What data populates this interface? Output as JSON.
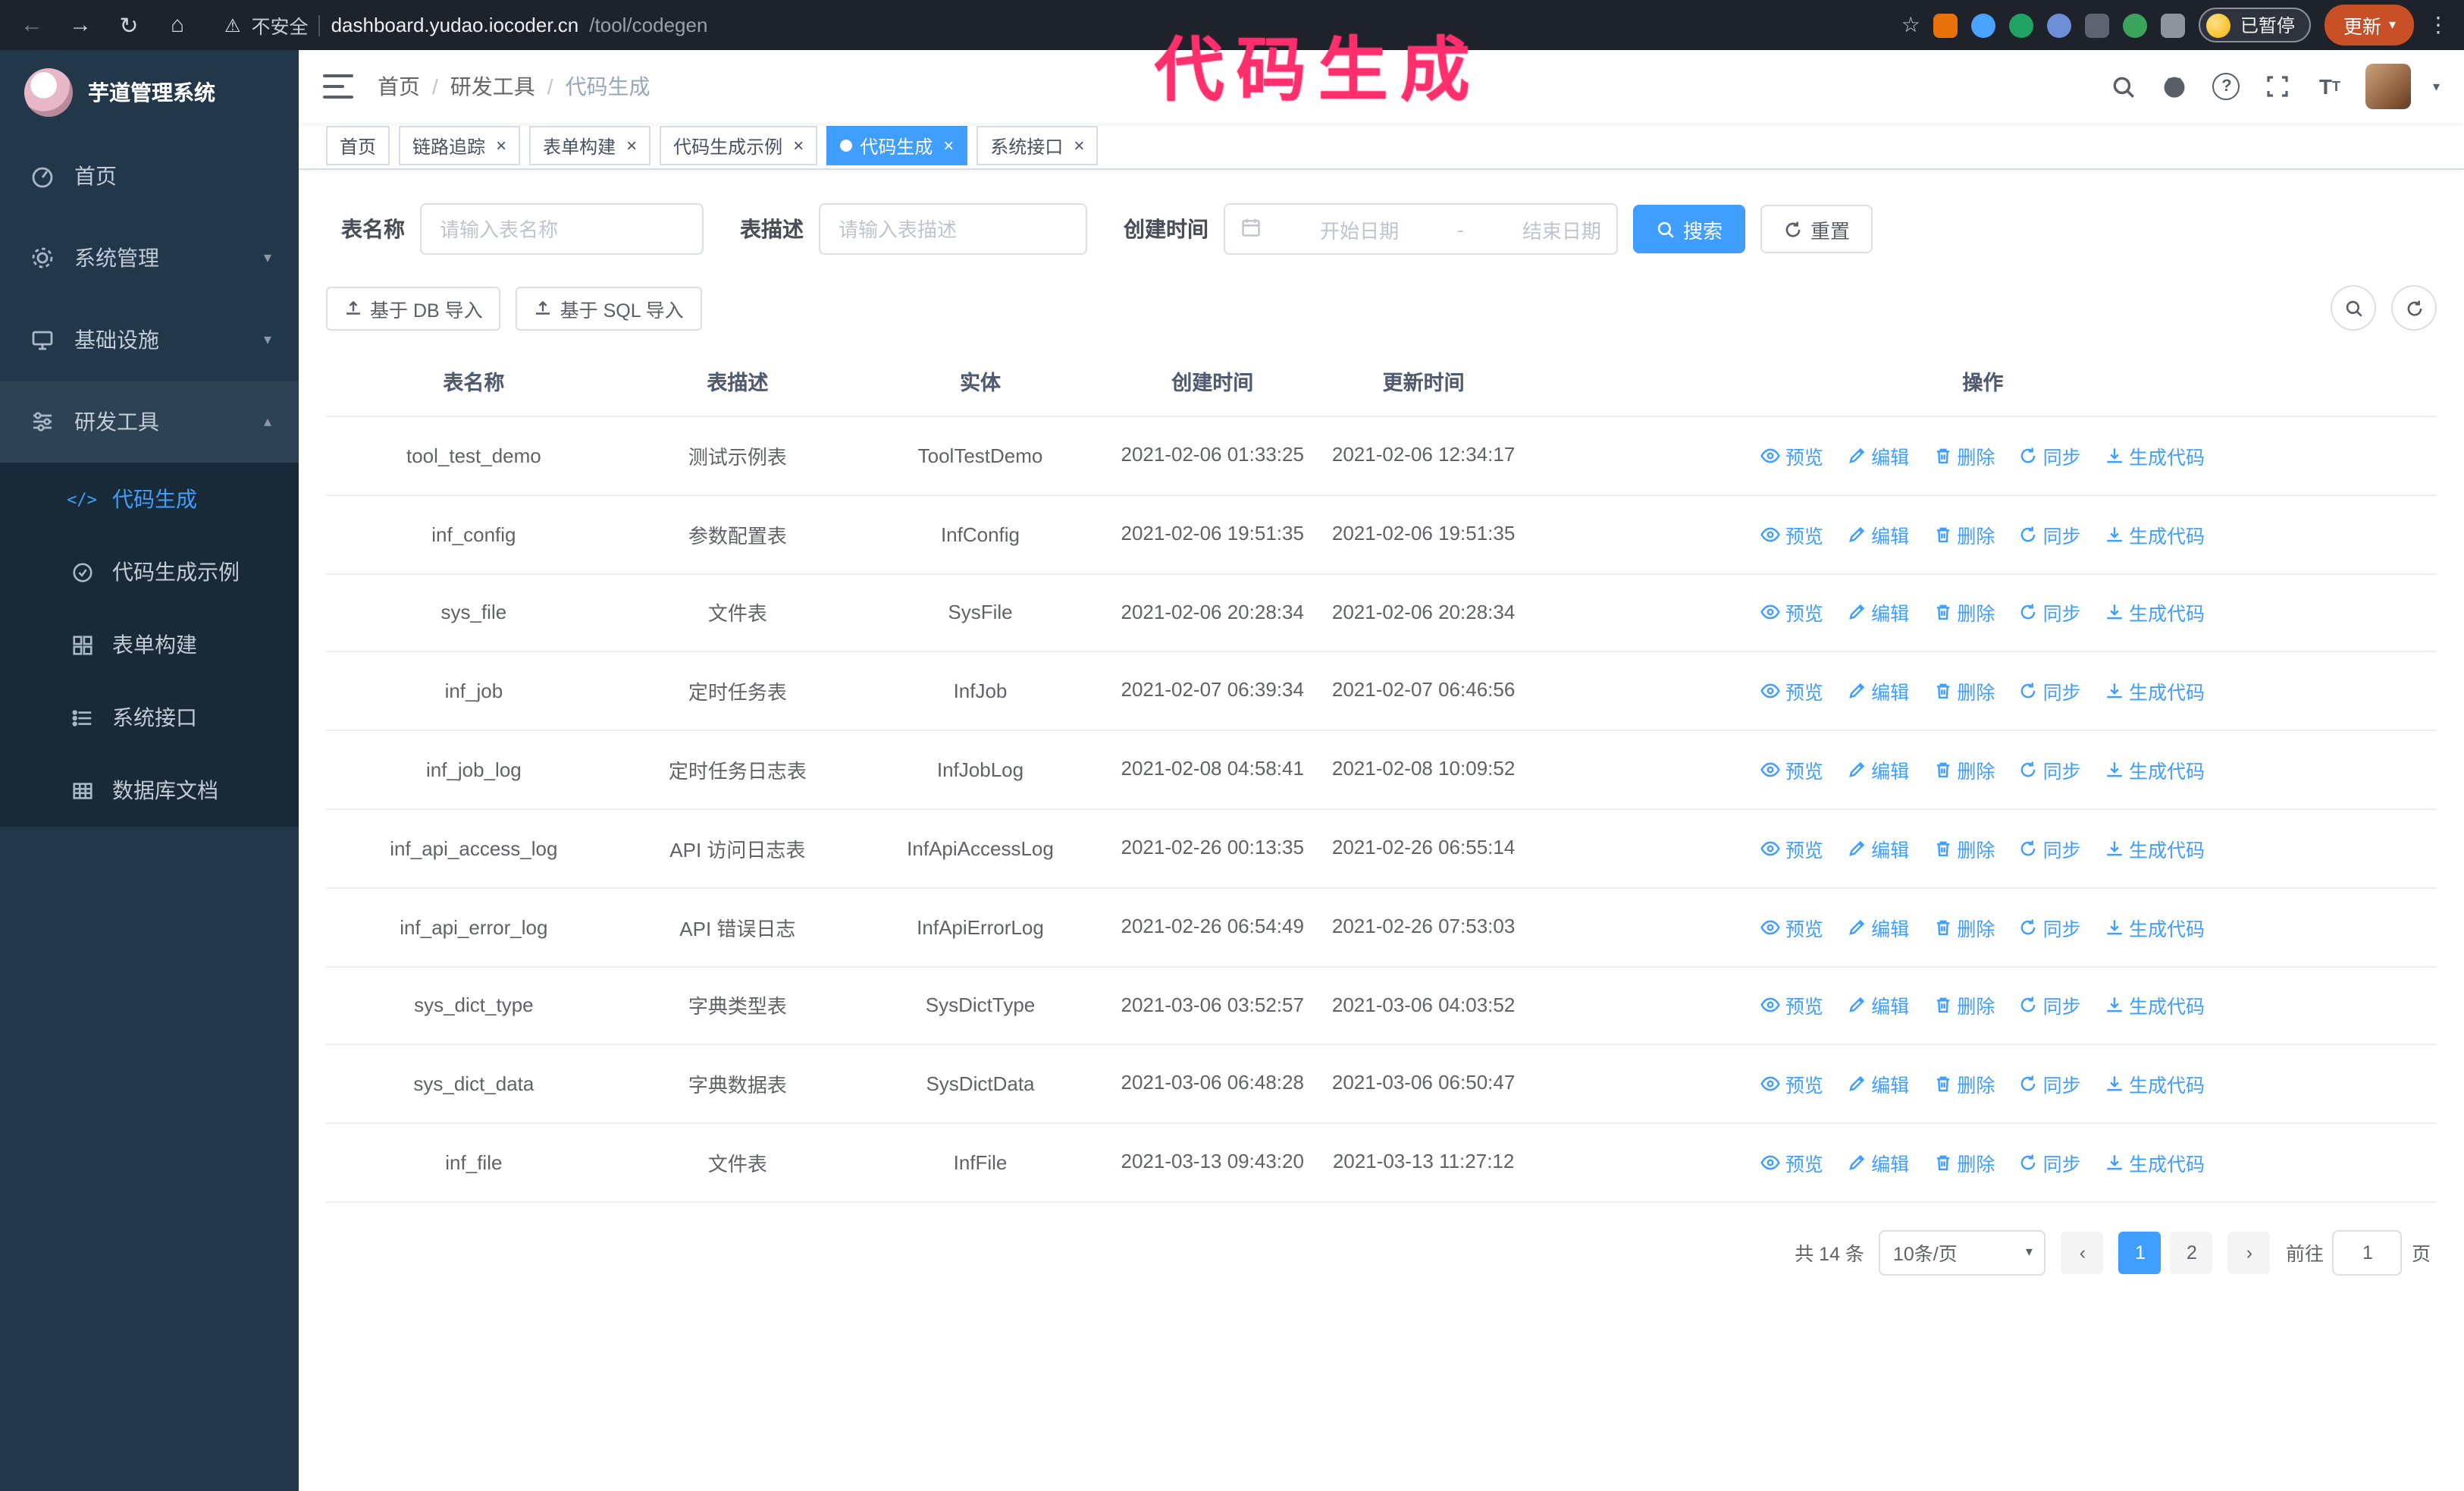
{
  "browser": {
    "security_label": "不安全",
    "url_host": "dashboard.yudao.iocoder.cn",
    "url_path": "/tool/codegen",
    "paused_badge": "已暂停",
    "update_button": "更新"
  },
  "annotation": {
    "text": "代码生成",
    "color": "#ff2f6d"
  },
  "sidebar": {
    "logo_title": "芋道管理系统",
    "items": [
      {
        "label": "首页"
      },
      {
        "label": "系统管理"
      },
      {
        "label": "基础设施"
      },
      {
        "label": "研发工具"
      }
    ],
    "submenu": [
      {
        "label": "代码生成",
        "active": true
      },
      {
        "label": "代码生成示例"
      },
      {
        "label": "表单构建"
      },
      {
        "label": "系统接口"
      },
      {
        "label": "数据库文档"
      }
    ]
  },
  "header": {
    "breadcrumb": [
      "首页",
      "研发工具",
      "代码生成"
    ],
    "breadcrumb_separator": "/"
  },
  "tabs": [
    {
      "label": "首页",
      "closable": false
    },
    {
      "label": "链路追踪",
      "closable": true
    },
    {
      "label": "表单构建",
      "closable": true
    },
    {
      "label": "代码生成示例",
      "closable": true
    },
    {
      "label": "代码生成",
      "closable": true,
      "active": true
    },
    {
      "label": "系统接口",
      "closable": true
    }
  ],
  "filters": {
    "table_name_label": "表名称",
    "table_name_placeholder": "请输入表名称",
    "table_desc_label": "表描述",
    "table_desc_placeholder": "请输入表描述",
    "create_time_label": "创建时间",
    "date_start_placeholder": "开始日期",
    "date_separator": "-",
    "date_end_placeholder": "结束日期",
    "search_button": "搜索",
    "reset_button": "重置"
  },
  "toolbar": {
    "import_db_button": "基于 DB 导入",
    "import_sql_button": "基于 SQL 导入"
  },
  "table": {
    "columns": [
      "表名称",
      "表描述",
      "实体",
      "创建时间",
      "更新时间",
      "操作"
    ],
    "actions": [
      "预览",
      "编辑",
      "删除",
      "同步",
      "生成代码"
    ],
    "rows": [
      {
        "name": "tool_test_demo",
        "desc": "测试示例表",
        "entity": "ToolTestDemo",
        "created": "2021-02-06 01:33:25",
        "updated": "2021-02-06 12:34:17"
      },
      {
        "name": "inf_config",
        "desc": "参数配置表",
        "entity": "InfConfig",
        "created": "2021-02-06 19:51:35",
        "updated": "2021-02-06 19:51:35"
      },
      {
        "name": "sys_file",
        "desc": "文件表",
        "entity": "SysFile",
        "created": "2021-02-06 20:28:34",
        "updated": "2021-02-06 20:28:34"
      },
      {
        "name": "inf_job",
        "desc": "定时任务表",
        "entity": "InfJob",
        "created": "2021-02-07 06:39:34",
        "updated": "2021-02-07 06:46:56"
      },
      {
        "name": "inf_job_log",
        "desc": "定时任务日志表",
        "entity": "InfJobLog",
        "created": "2021-02-08 04:58:41",
        "updated": "2021-02-08 10:09:52"
      },
      {
        "name": "inf_api_access_log",
        "desc": "API 访问日志表",
        "entity": "InfApiAccessLog",
        "created": "2021-02-26 00:13:35",
        "updated": "2021-02-26 06:55:14"
      },
      {
        "name": "inf_api_error_log",
        "desc": "API 错误日志",
        "entity": "InfApiErrorLog",
        "created": "2021-02-26 06:54:49",
        "updated": "2021-02-26 07:53:03"
      },
      {
        "name": "sys_dict_type",
        "desc": "字典类型表",
        "entity": "SysDictType",
        "created": "2021-03-06 03:52:57",
        "updated": "2021-03-06 04:03:52"
      },
      {
        "name": "sys_dict_data",
        "desc": "字典数据表",
        "entity": "SysDictData",
        "created": "2021-03-06 06:48:28",
        "updated": "2021-03-06 06:50:47"
      },
      {
        "name": "inf_file",
        "desc": "文件表",
        "entity": "InfFile",
        "created": "2021-03-13 09:43:20",
        "updated": "2021-03-13 11:27:12"
      }
    ]
  },
  "pagination": {
    "total": "共 14 条",
    "page_size": "10条/页",
    "pages": [
      {
        "num": "1",
        "active": true
      },
      {
        "num": "2"
      }
    ],
    "prev": "‹",
    "next": "›",
    "goto_label": "前往",
    "goto_value": "1",
    "goto_suffix": "页"
  }
}
